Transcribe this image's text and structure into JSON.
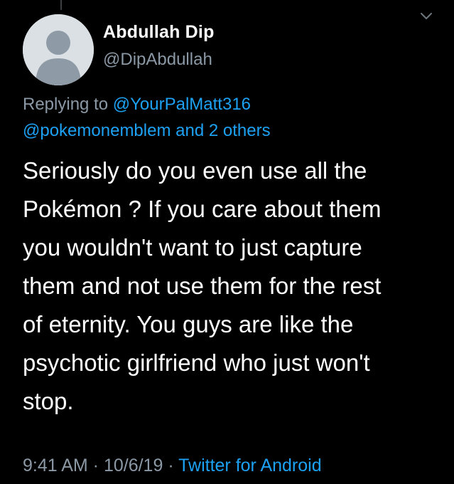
{
  "tweet": {
    "author_name": "Abdullah Dip",
    "author_handle": "@DipAbdullah",
    "replying_prefix": "Replying to ",
    "reply_to_primary": "@YourPalMatt316",
    "reply_to_secondary": "@pokemonemblem",
    "reply_conjunction": " and ",
    "reply_others": "2 others",
    "text": "Seriously do you even use all the\nPokémon ? If you care about them\nyou wouldn't want to just capture\nthem and not use them for the rest\nof eternity. You guys are like the\npsychotic girlfriend who just won't\nstop.",
    "time": "9:41 AM",
    "separator": " · ",
    "date": "10/6/19",
    "source": "Twitter for Android"
  },
  "icons": {
    "menu": "chevron-down-icon",
    "avatar": "default-avatar-icon"
  },
  "colors": {
    "background": "#000000",
    "primary_text": "#ffffff",
    "secondary_text": "#8b98a5",
    "link": "#1da1f2"
  }
}
